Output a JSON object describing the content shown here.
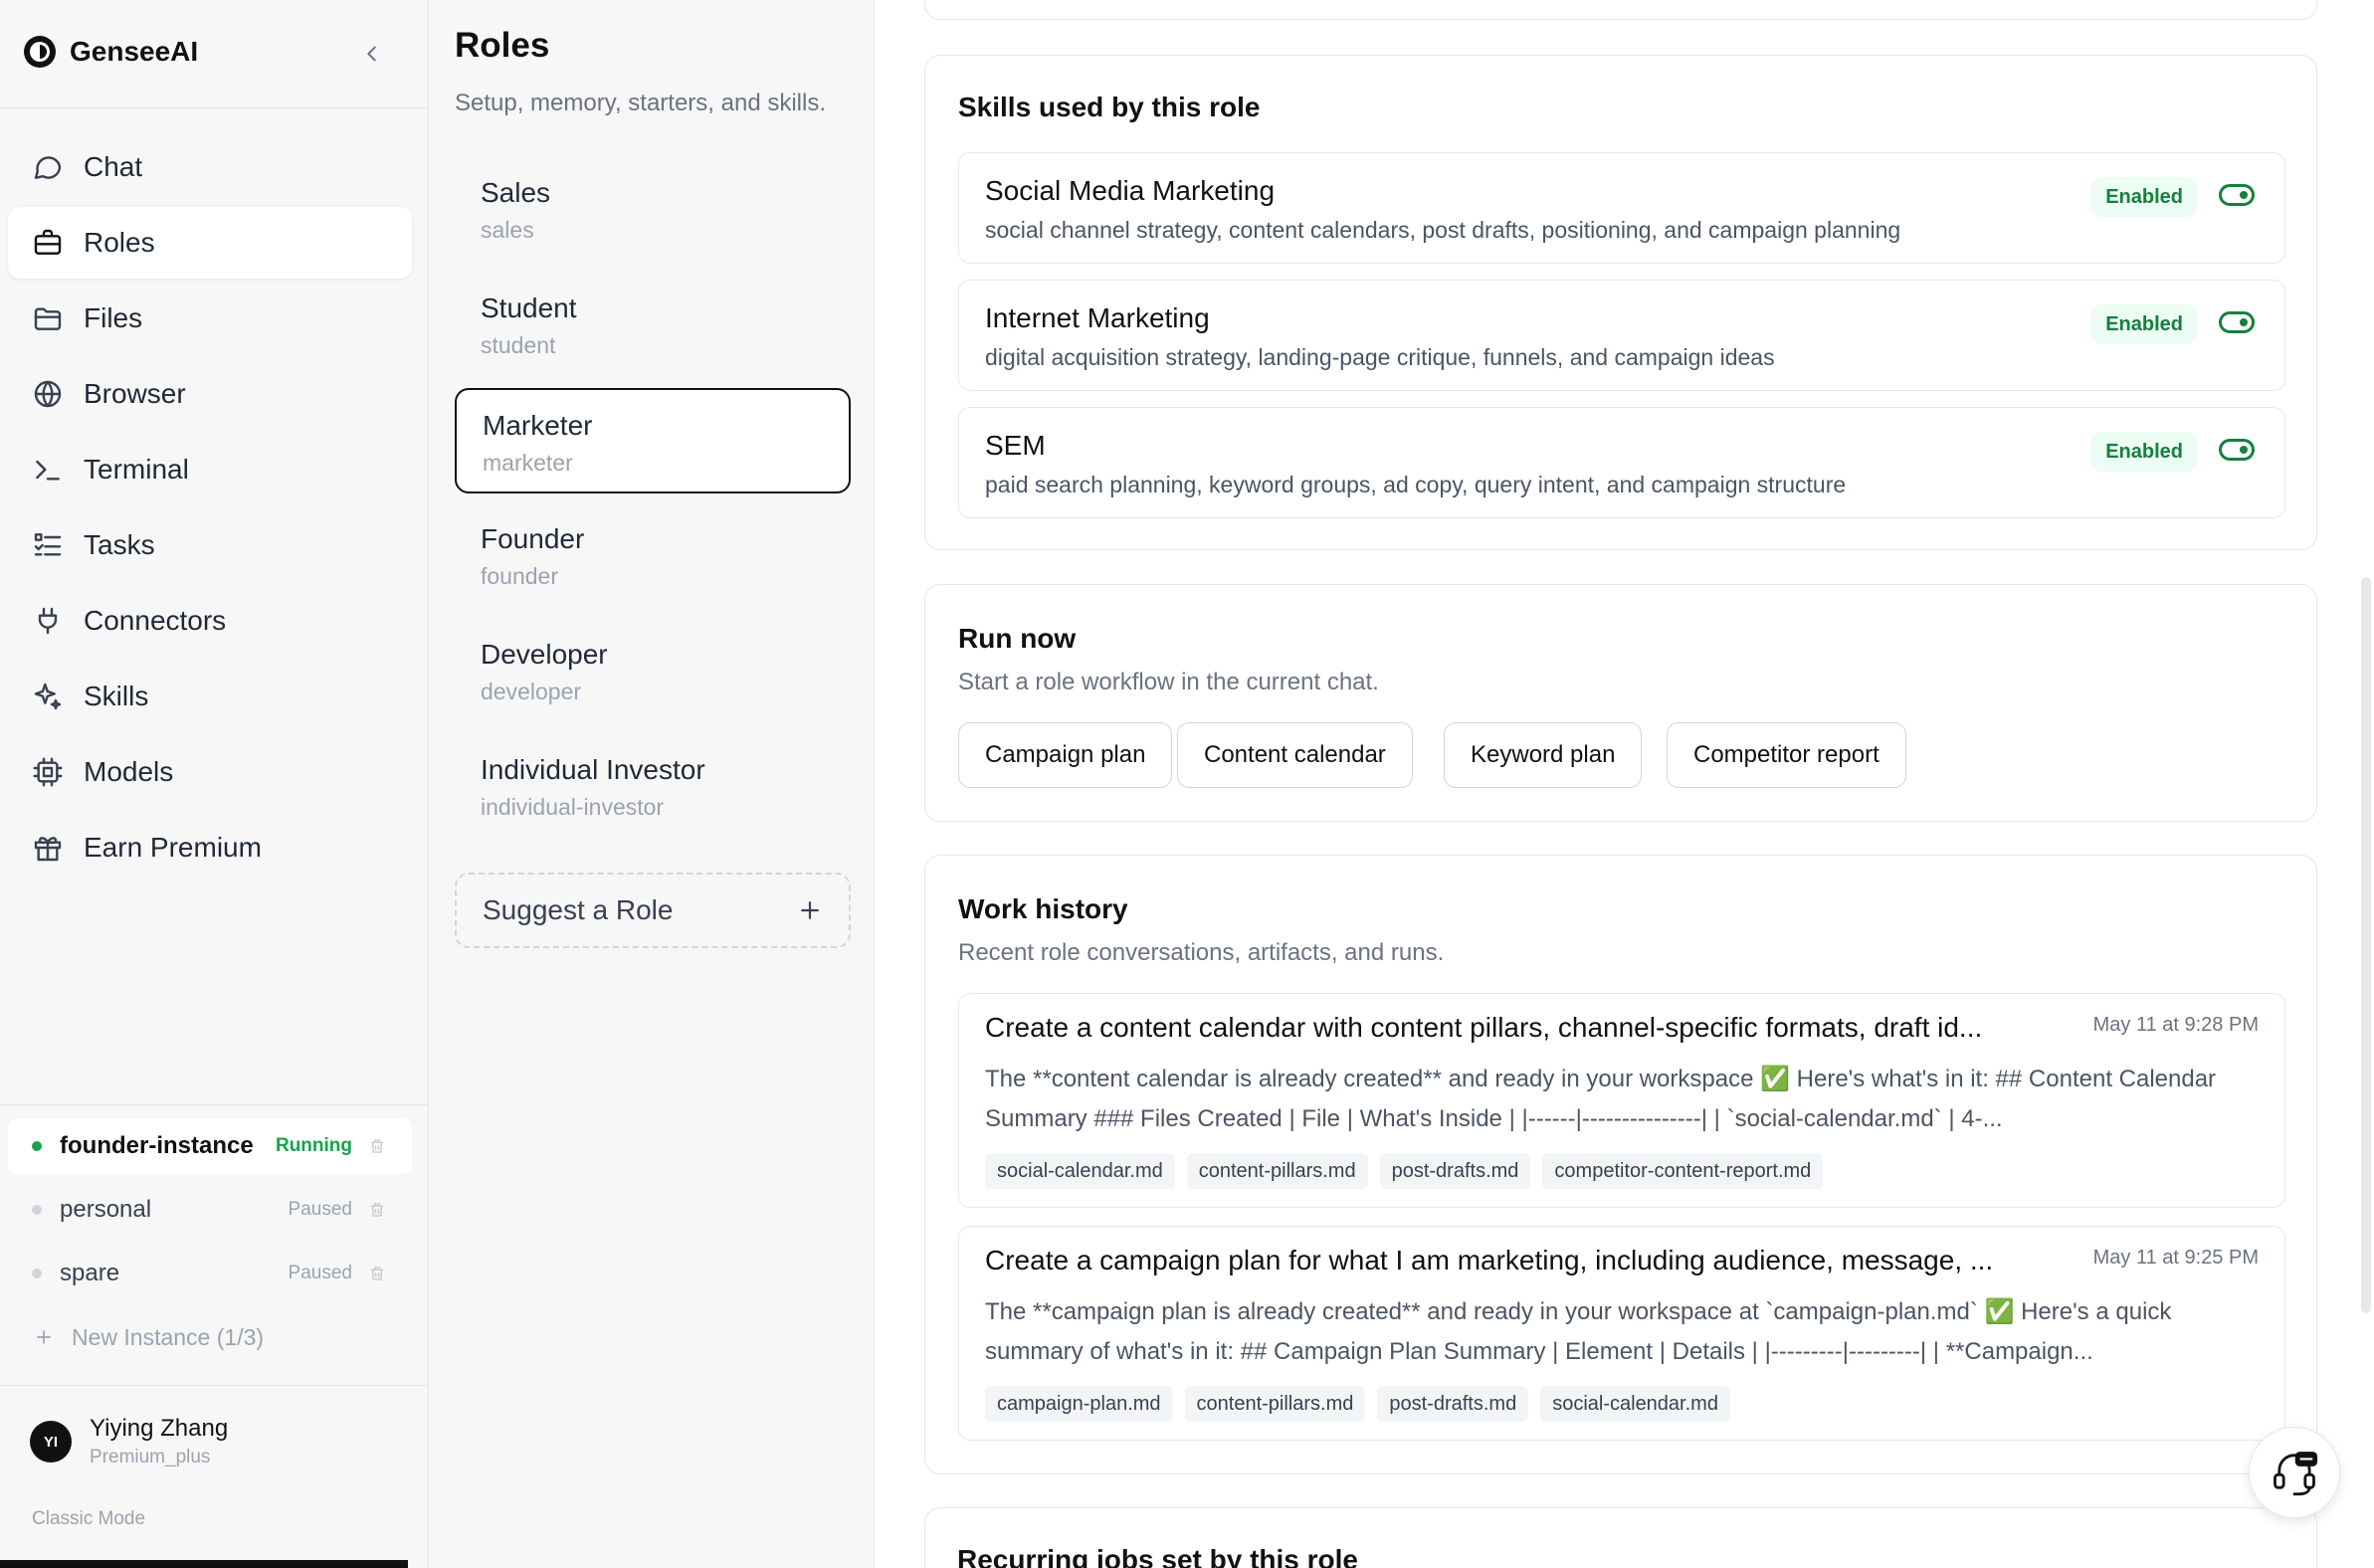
{
  "brand": {
    "name": "GenseeAI"
  },
  "nav": {
    "items": [
      {
        "label": "Chat",
        "icon": "chat-icon"
      },
      {
        "label": "Roles",
        "icon": "briefcase-icon",
        "active": true
      },
      {
        "label": "Files",
        "icon": "folder-icon"
      },
      {
        "label": "Browser",
        "icon": "globe-icon"
      },
      {
        "label": "Terminal",
        "icon": "terminal-icon"
      },
      {
        "label": "Tasks",
        "icon": "tasks-icon"
      },
      {
        "label": "Connectors",
        "icon": "plug-icon"
      },
      {
        "label": "Skills",
        "icon": "sparkle-icon"
      },
      {
        "label": "Models",
        "icon": "chip-icon"
      },
      {
        "label": "Earn Premium",
        "icon": "gift-icon"
      }
    ]
  },
  "instances": {
    "items": [
      {
        "name": "founder-instance",
        "status": "Running",
        "active": true
      },
      {
        "name": "personal",
        "status": "Paused"
      },
      {
        "name": "spare",
        "status": "Paused"
      }
    ],
    "new_label": "New Instance (1/3)"
  },
  "user": {
    "initials": "YI",
    "name": "Yiying Zhang",
    "plan": "Premium_plus"
  },
  "classic_mode": "Classic Mode",
  "roles": {
    "title": "Roles",
    "subtitle": "Setup, memory, starters, and skills.",
    "items": [
      {
        "name": "Sales",
        "slug": "sales"
      },
      {
        "name": "Student",
        "slug": "student"
      },
      {
        "name": "Marketer",
        "slug": "marketer",
        "active": true
      },
      {
        "name": "Founder",
        "slug": "founder"
      },
      {
        "name": "Developer",
        "slug": "developer"
      },
      {
        "name": "Individual Investor",
        "slug": "individual-investor"
      }
    ],
    "suggest_label": "Suggest a Role"
  },
  "skills_card": {
    "title": "Skills used by this role",
    "items": [
      {
        "name": "Social Media Marketing",
        "desc": "social channel strategy, content calendars, post drafts, positioning, and campaign planning",
        "status": "Enabled"
      },
      {
        "name": "Internet Marketing",
        "desc": "digital acquisition strategy, landing-page critique, funnels, and campaign ideas",
        "status": "Enabled"
      },
      {
        "name": "SEM",
        "desc": "paid search planning, keyword groups, ad copy, query intent, and campaign structure",
        "status": "Enabled"
      }
    ]
  },
  "run_now": {
    "title": "Run now",
    "subtitle": "Start a role workflow in the current chat.",
    "buttons": [
      "Campaign plan",
      "Content calendar",
      "Keyword plan",
      "Competitor report"
    ]
  },
  "work_history": {
    "title": "Work history",
    "subtitle": "Recent role conversations, artifacts, and runs.",
    "items": [
      {
        "title": "Create a content calendar with content pillars, channel-specific formats, draft id...",
        "time": "May 11 at 9:28 PM",
        "body": "The **content calendar is already created** and ready in your workspace ✅ Here's what's in it: ## Content Calendar Summary ### Files Created | File | What's Inside | |------|---------------| | `social-calendar.md` | 4-...",
        "tags": [
          "social-calendar.md",
          "content-pillars.md",
          "post-drafts.md",
          "competitor-content-report.md"
        ]
      },
      {
        "title": "Create a campaign plan for what I am marketing, including audience, message, ...",
        "time": "May 11 at 9:25 PM",
        "body": "The **campaign plan is already created** and ready in your workspace at `campaign-plan.md` ✅ Here's a quick summary of what's in it: ## Campaign Plan Summary | Element | Details | |---------|---------| | **Campaign...",
        "tags": [
          "campaign-plan.md",
          "content-pillars.md",
          "post-drafts.md",
          "social-calendar.md"
        ]
      }
    ]
  },
  "recurring": {
    "title": "Recurring jobs set by this role"
  }
}
